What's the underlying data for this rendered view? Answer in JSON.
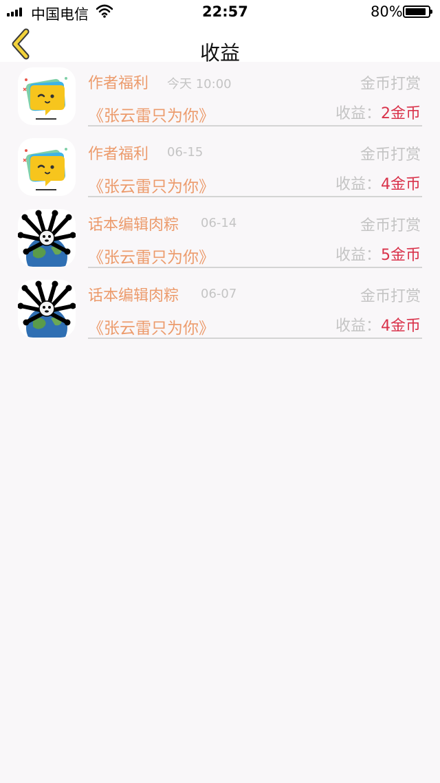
{
  "status_bar": {
    "carrier": "中国电信",
    "time": "22:57",
    "battery": "80%"
  },
  "nav": {
    "title": "收益",
    "back_icon": "chevron-left-icon"
  },
  "colors": {
    "name": "#ec9b6c",
    "amount": "#d9324a",
    "muted": "#c4c4c4",
    "back_chevron": "#f2d23a"
  },
  "records": [
    {
      "avatar": "chat-bubble-app-icon",
      "name": "作者福利",
      "date": "今天 10:00",
      "type": "金币打赏",
      "book": "《张云雷只为你》",
      "earning_label": "收益：",
      "amount": "2金币"
    },
    {
      "avatar": "chat-bubble-app-icon",
      "name": "作者福利",
      "date": "06-15",
      "type": "金币打赏",
      "book": "《张云雷只为你》",
      "earning_label": "收益：",
      "amount": "4金币"
    },
    {
      "avatar": "spider-panda-globe-avatar",
      "name": "话本编辑肉粽",
      "date": "06-14",
      "type": "金币打赏",
      "book": "《张云雷只为你》",
      "earning_label": "收益：",
      "amount": "5金币"
    },
    {
      "avatar": "spider-panda-globe-avatar",
      "name": "话本编辑肉粽",
      "date": "06-07",
      "type": "金币打赏",
      "book": "《张云雷只为你》",
      "earning_label": "收益：",
      "amount": "4金币"
    }
  ]
}
